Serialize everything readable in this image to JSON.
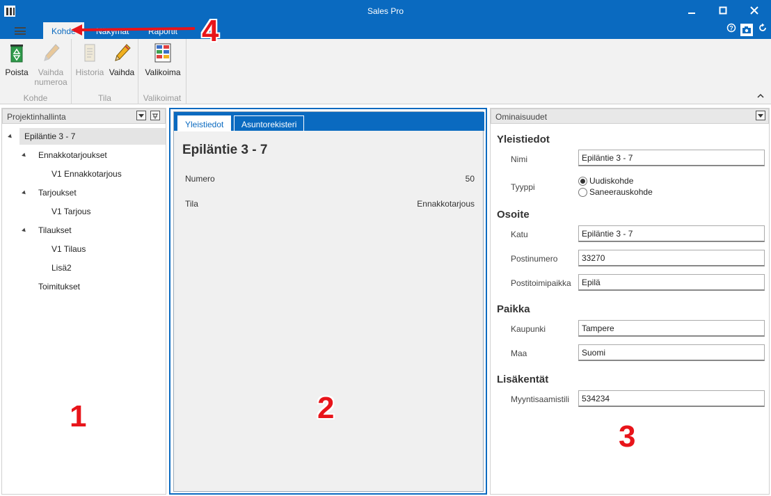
{
  "window": {
    "title": "Sales Pro"
  },
  "ribbon_tabs": [
    "Kohde",
    "Näkymät",
    "Raportit"
  ],
  "ribbon_groups": [
    {
      "label": "Kohde",
      "buttons": [
        {
          "label": "Poista",
          "enabled": true
        },
        {
          "label": "Vaihda numeroa",
          "enabled": false
        }
      ]
    },
    {
      "label": "Tila",
      "buttons": [
        {
          "label": "Historia",
          "enabled": false
        },
        {
          "label": "Vaihda",
          "enabled": true
        }
      ]
    },
    {
      "label": "Valikoimat",
      "buttons": [
        {
          "label": "Valikoima",
          "enabled": true
        }
      ]
    }
  ],
  "left_pane": {
    "title": "Projektinhallinta",
    "tree": [
      {
        "label": "Epiläntie 3 - 7"
      },
      {
        "label": "Ennakkotarjoukset"
      },
      {
        "label": "V1 Ennakkotarjous"
      },
      {
        "label": "Tarjoukset"
      },
      {
        "label": "V1 Tarjous"
      },
      {
        "label": "Tilaukset"
      },
      {
        "label": "V1 Tilaus"
      },
      {
        "label": "Lisä2"
      },
      {
        "label": "Toimitukset"
      }
    ]
  },
  "middle_pane": {
    "tabs": [
      "Yleistiedot",
      "Asuntorekisteri"
    ],
    "title": "Epiläntie 3 - 7",
    "rows": [
      {
        "label": "Numero",
        "value": "50"
      },
      {
        "label": "Tila",
        "value": "Ennakkotarjous"
      }
    ]
  },
  "right_pane": {
    "title": "Ominaisuudet",
    "sections": {
      "yleistiedot": "Yleistiedot",
      "osoite": "Osoite",
      "paikka": "Paikka",
      "lisakentat": "Lisäkentät"
    },
    "fields": {
      "nimi": {
        "label": "Nimi",
        "value": "Epiläntie 3 - 7"
      },
      "tyyppi": {
        "label": "Tyyppi",
        "options": [
          "Uudiskohde",
          "Saneerauskohde"
        ],
        "selected": "Uudiskohde"
      },
      "katu": {
        "label": "Katu",
        "value": "Epiläntie 3 - 7"
      },
      "postinumero": {
        "label": "Postinumero",
        "value": "33270"
      },
      "postitoimipaikka": {
        "label": "Postitoimipaikka",
        "value": "Epilä"
      },
      "kaupunki": {
        "label": "Kaupunki",
        "value": "Tampere"
      },
      "maa": {
        "label": "Maa",
        "value": "Suomi"
      },
      "myyntisaamistili": {
        "label": "Myyntisaamistili",
        "value": "534234"
      }
    }
  },
  "callouts": [
    "1",
    "2",
    "3",
    "4"
  ],
  "colors": {
    "accent": "#0a6ac0",
    "callout": "#e8141a"
  }
}
